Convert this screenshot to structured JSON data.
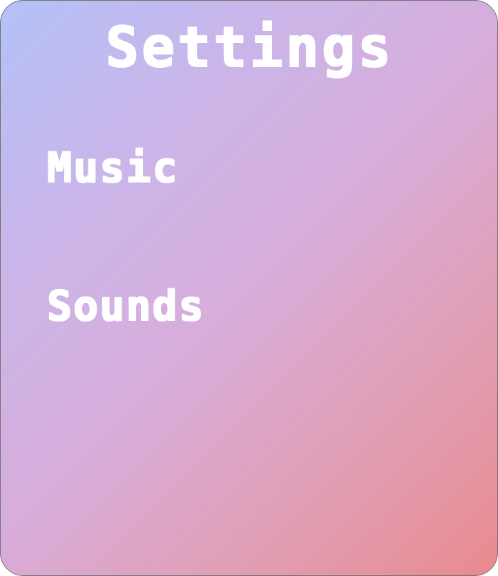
{
  "title": "Settings",
  "menu": {
    "music_label": "Music",
    "sounds_label": "Sounds"
  },
  "colors": {
    "gradient_start": "#b3c1f7",
    "gradient_end": "#e98a8e",
    "text": "#ffffff",
    "border": "#6f6f6f"
  }
}
